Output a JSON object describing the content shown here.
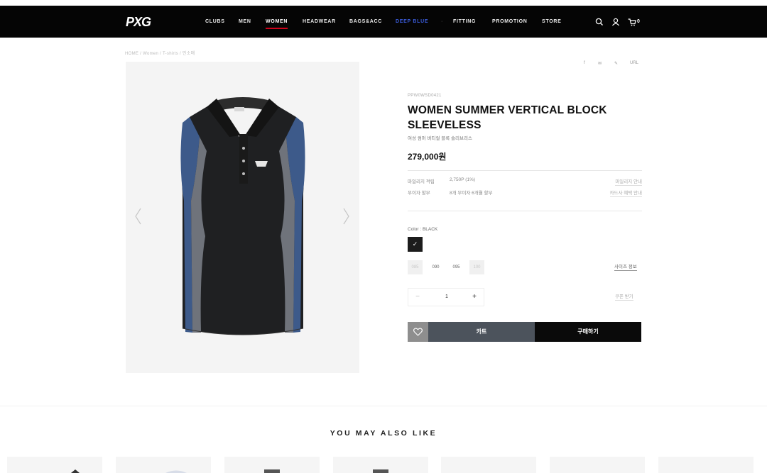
{
  "brand": {
    "logo_text": "PXG"
  },
  "nav": {
    "items": [
      {
        "label": "CLUBS",
        "slug": "clubs",
        "state": "normal"
      },
      {
        "label": "MEN",
        "slug": "men",
        "state": "normal"
      },
      {
        "label": "WOMEN",
        "slug": "women",
        "state": "active"
      },
      {
        "label": "HEADWEAR",
        "slug": "headwear",
        "state": "normal"
      },
      {
        "label": "BAGS&ACC",
        "slug": "bags-acc",
        "state": "normal"
      },
      {
        "label": "DEEP BLUE",
        "slug": "deep-blue",
        "state": "highlight"
      },
      {
        "label": "FITTING",
        "slug": "fitting",
        "state": "normal"
      },
      {
        "label": "PROMOTION",
        "slug": "promotion",
        "state": "normal"
      },
      {
        "label": "STORE",
        "slug": "store",
        "state": "normal"
      }
    ],
    "separator": "·",
    "cart_count": "0",
    "icons": [
      "search-icon",
      "user-icon",
      "cart-icon"
    ],
    "colors": {
      "background": "#050505",
      "active_underline": "#d0021b",
      "highlight": "#3a5bd9"
    }
  },
  "breadcrumb": "HOME  /  Women  /  T-shirts  /  민소매",
  "share": {
    "links": [
      "f",
      "✉",
      "✎",
      "URL"
    ]
  },
  "product": {
    "code": "PPW0WSD0421",
    "title": "WOMEN SUMMER VERTICAL BLOCK SLEEVELESS",
    "subtitle": "여성 썸머 버티컬 블록 슬리브리스",
    "price": "279,000원",
    "mileage_label": "마일리지 적립",
    "mileage_value": "2,750P (1%)",
    "mileage_link": "마일리지 안내",
    "installment_label": "무이자 할부",
    "installment_value": "8개 무이자 6개월 할부",
    "installment_link": "카드사 혜택 안내",
    "color_label": "Color : BLACK",
    "color_swatch_check": "✓",
    "colors": {
      "swatch": "#1c1c1c"
    },
    "sizes": [
      {
        "label": "085",
        "available": false
      },
      {
        "label": "090",
        "available": true
      },
      {
        "label": "095",
        "available": true
      },
      {
        "label": "100",
        "available": false
      }
    ],
    "size_guide_link": "사이즈 정보",
    "quantity": {
      "minus": "−",
      "value": "1",
      "plus": "+"
    },
    "coupon_link": "쿠폰 받기",
    "cart_label": "카트",
    "buy_label": "구매하기"
  },
  "recommendations": {
    "heading": "YOU MAY ALSO LIKE"
  }
}
